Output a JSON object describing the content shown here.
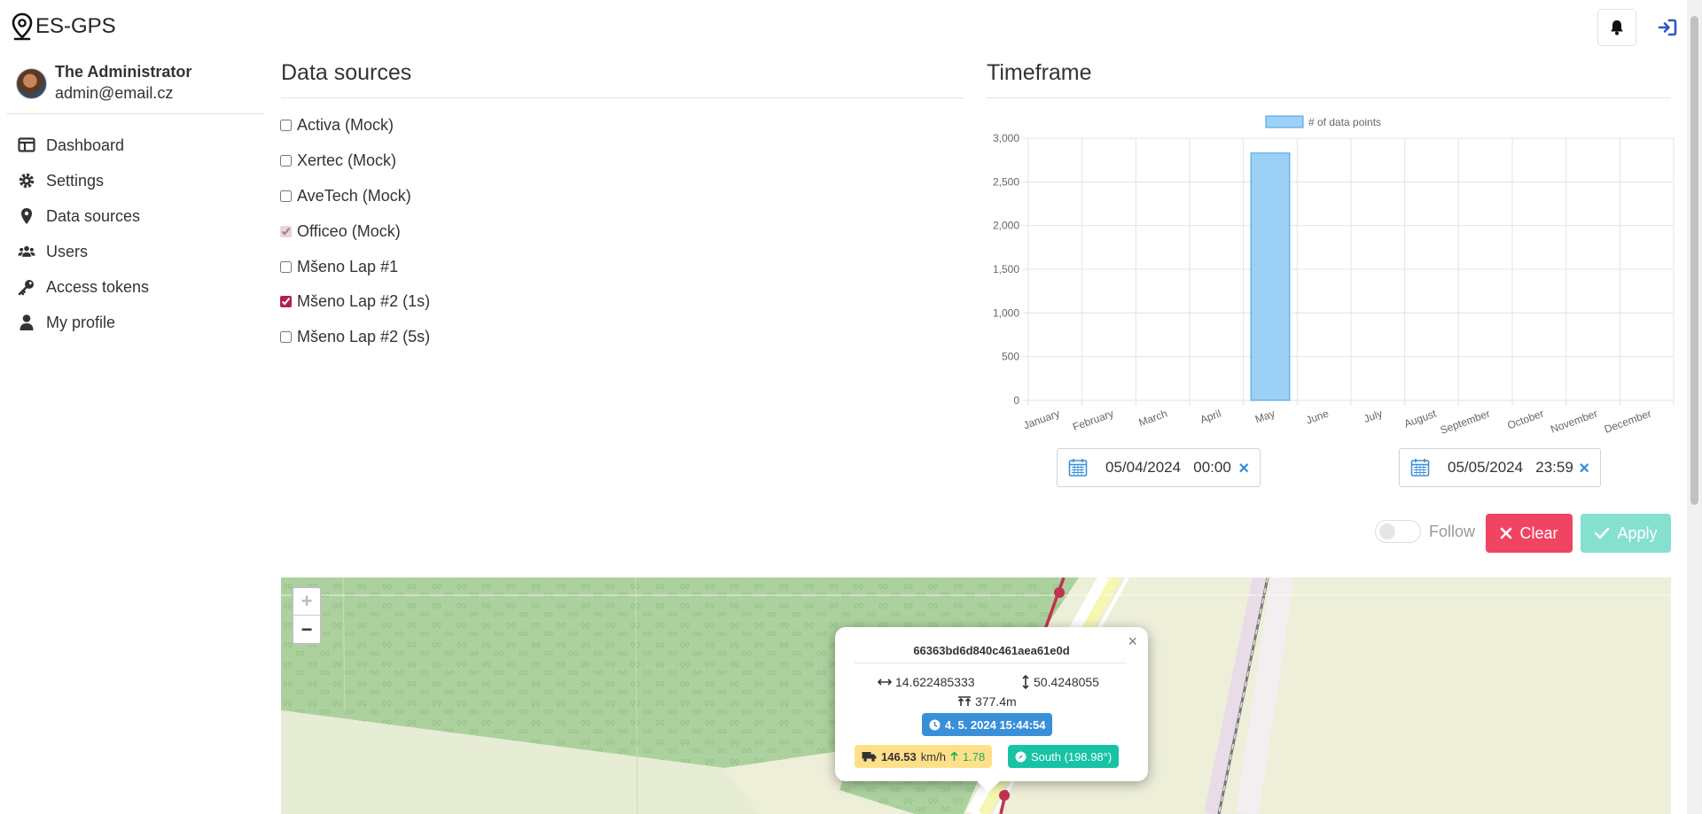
{
  "app": {
    "title": "ES-GPS"
  },
  "user": {
    "name": "The Administrator",
    "email": "admin@email.cz"
  },
  "sidebar": {
    "items": [
      {
        "label": "Dashboard",
        "icon": "dashboard-icon"
      },
      {
        "label": "Settings",
        "icon": "gear-icon"
      },
      {
        "label": "Data sources",
        "icon": "map-pin-icon"
      },
      {
        "label": "Users",
        "icon": "users-icon"
      },
      {
        "label": "Access tokens",
        "icon": "key-icon"
      },
      {
        "label": "My profile",
        "icon": "user-icon"
      }
    ]
  },
  "data_sources": {
    "title": "Data sources",
    "items": [
      {
        "label": "Activa (Mock)",
        "checked": false
      },
      {
        "label": "Xertec (Mock)",
        "checked": false
      },
      {
        "label": "AveTech (Mock)",
        "checked": false
      },
      {
        "label": "Officeo (Mock)",
        "checked": true,
        "disabled": true
      },
      {
        "label": "Mšeno Lap #1",
        "checked": false
      },
      {
        "label": "Mšeno Lap #2 (1s)",
        "checked": true
      },
      {
        "label": "Mšeno Lap #2 (5s)",
        "checked": false
      }
    ]
  },
  "timeframe": {
    "title": "Timeframe",
    "from": "05/04/2024   00:00",
    "to": "05/05/2024   23:59",
    "clear_glyph": "×"
  },
  "chart_data": {
    "type": "bar",
    "legend": "# of data points",
    "legend_position": "top",
    "categories": [
      "January",
      "February",
      "March",
      "April",
      "May",
      "June",
      "July",
      "August",
      "September",
      "October",
      "November",
      "December"
    ],
    "values": [
      0,
      0,
      0,
      0,
      2830,
      0,
      0,
      0,
      0,
      0,
      0,
      0
    ],
    "ylim": [
      0,
      3000
    ],
    "yticks": [
      0,
      500,
      1000,
      1500,
      2000,
      2500,
      3000
    ],
    "ytick_labels": [
      "0",
      "500",
      "1,000",
      "1,500",
      "2,000",
      "2,500",
      "3,000"
    ],
    "grid": true,
    "bar_color": "#9dd0f5",
    "bar_border": "#3ea2e8"
  },
  "controls": {
    "follow_label": "Follow",
    "follow_on": false,
    "clear_label": "Clear",
    "apply_label": "Apply"
  },
  "map": {
    "zoom_in": "+",
    "zoom_out": "−",
    "popup": {
      "id": "66363bd6d840c461aea61e0d",
      "longitude": "14.622485333",
      "latitude": "50.4248055",
      "altitude": "377.4m",
      "time": "4. 5. 2024 15:44:54",
      "speed": "146.53",
      "speed_unit": "km/h",
      "speed_change": "1.78",
      "direction": "South (198.98°)",
      "close": "×"
    }
  },
  "colors": {
    "clear_button": "#f04462",
    "apply_button": "#86e0d0",
    "time_badge": "#3a8fd9",
    "speed_badge": "#ffe08a",
    "direction_badge": "#17c3a5",
    "track": "#c0334f"
  }
}
